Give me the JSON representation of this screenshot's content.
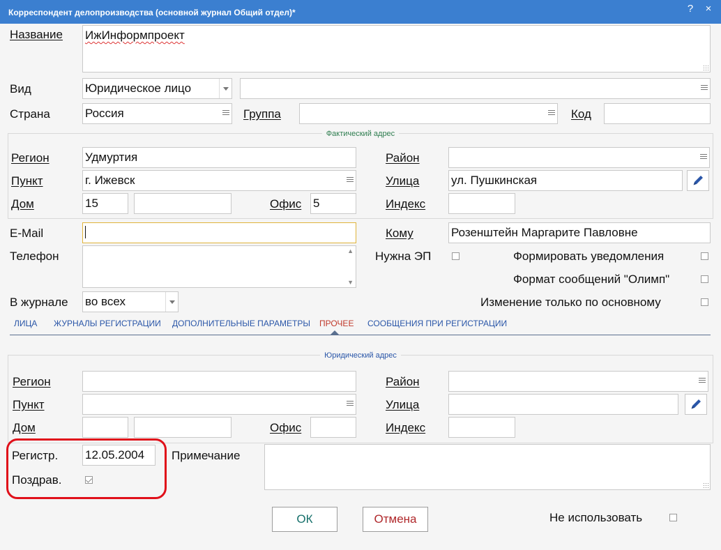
{
  "window": {
    "title": "Корреспондент делопроизводства (основной журнал Общий отдел)*",
    "help_btn": "?",
    "close_btn": "×"
  },
  "name_label": "Название",
  "name_value": "ИжИнформпроект",
  "kind_label": "Вид",
  "kind_value": "Юридическое лицо",
  "kind_extra_value": "",
  "country_label": "Страна",
  "country_value": "Россия",
  "group_label": "Группа",
  "group_value": "",
  "code_label": "Код",
  "code_value": "",
  "actual_address": {
    "legend": "Фактический адрес",
    "region_label": "Регион",
    "region_value": "Удмуртия",
    "district_label": "Район",
    "district_value": "",
    "locality_label": "Пункт",
    "locality_value": "г. Ижевск",
    "street_label": "Улица",
    "street_value": "ул. Пушкинская",
    "house_label": "Дом",
    "house_value": "15",
    "house_extra_value": "",
    "office_label": "Офис",
    "office_value": "5",
    "index_label": "Индекс",
    "index_value": ""
  },
  "email_label": "E-Mail",
  "email_value": "",
  "to_whom_label": "Кому",
  "to_whom_value": "Розенштейн Маргарите Павловне",
  "phone_label": "Телефон",
  "phone_value": "",
  "need_ep_label": "Нужна ЭП",
  "need_ep_checked": false,
  "form_notifications_label": "Формировать уведомления",
  "form_notifications_checked": false,
  "olymp_format_label": "Формат сообщений \"Олимп\"",
  "olymp_format_checked": false,
  "journal_label": "В журнале",
  "journal_value": "во всех",
  "main_only_label": "Изменение только по основному",
  "main_only_checked": false,
  "tabs": [
    {
      "label": "ЛИЦА",
      "active": false
    },
    {
      "label": "ЖУРНАЛЫ РЕГИСТРАЦИИ",
      "active": false
    },
    {
      "label": "ДОПОЛНИТЕЛЬНЫЕ ПАРАМЕТРЫ",
      "active": false
    },
    {
      "label": "ПРОЧЕЕ",
      "active": true
    },
    {
      "label": "СООБЩЕНИЯ ПРИ РЕГИСТРАЦИИ",
      "active": false
    }
  ],
  "legal_address": {
    "legend": "Юридический адрес",
    "region_label": "Регион",
    "region_value": "",
    "district_label": "Район",
    "district_value": "",
    "locality_label": "Пункт",
    "locality_value": "",
    "street_label": "Улица",
    "street_value": "",
    "house_label": "Дом",
    "house_value": "",
    "house_extra_value": "",
    "office_label": "Офис",
    "office_value": "",
    "index_label": "Индекс",
    "index_value": ""
  },
  "reg_label": "Регистр.",
  "reg_value": "12.05.2004",
  "greeting_label": "Поздрав.",
  "greeting_checked": true,
  "note_label": "Примечание",
  "note_value": "",
  "ok_label": "ОК",
  "cancel_label": "Отмена",
  "not_use_label": "Не использовать",
  "not_use_checked": false,
  "colors": {
    "title_bg": "#3b7fd0",
    "ok_text": "#16706b",
    "cancel_text": "#b0282b",
    "legend_actual": "#2e7d4f",
    "legend_legal": "#2a56a8",
    "highlight": "#e0101a"
  }
}
